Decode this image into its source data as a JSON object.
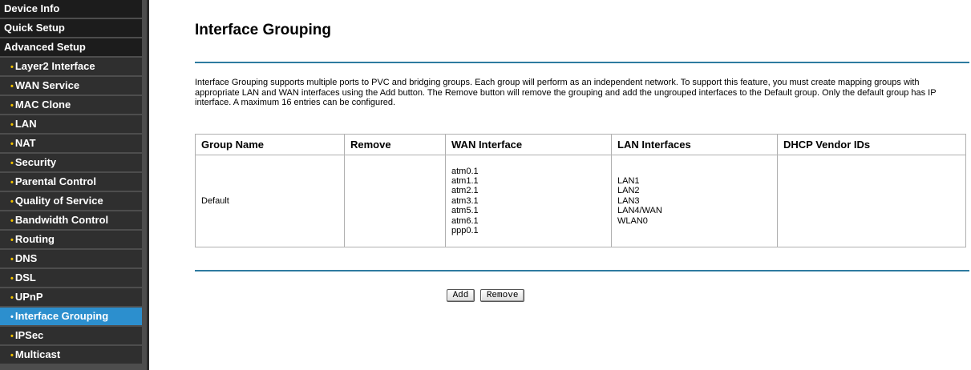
{
  "sidebar": {
    "items": [
      {
        "label": "Device Info",
        "type": "top"
      },
      {
        "label": "Quick Setup",
        "type": "top"
      },
      {
        "label": "Advanced Setup",
        "type": "top"
      },
      {
        "label": "Layer2 Interface",
        "type": "sub"
      },
      {
        "label": "WAN Service",
        "type": "sub"
      },
      {
        "label": "MAC Clone",
        "type": "sub"
      },
      {
        "label": "LAN",
        "type": "sub"
      },
      {
        "label": "NAT",
        "type": "sub"
      },
      {
        "label": "Security",
        "type": "sub"
      },
      {
        "label": "Parental Control",
        "type": "sub"
      },
      {
        "label": "Quality of Service",
        "type": "sub"
      },
      {
        "label": "Bandwidth Control",
        "type": "sub"
      },
      {
        "label": "Routing",
        "type": "sub"
      },
      {
        "label": "DNS",
        "type": "sub"
      },
      {
        "label": "DSL",
        "type": "sub"
      },
      {
        "label": "UPnP",
        "type": "sub"
      },
      {
        "label": "Interface Grouping",
        "type": "sub",
        "active": true
      },
      {
        "label": "IPSec",
        "type": "sub"
      },
      {
        "label": "Multicast",
        "type": "sub"
      }
    ],
    "bullet": "•"
  },
  "main": {
    "title": "Interface Grouping",
    "description": "Interface Grouping supports multiple ports to PVC and bridging groups. Each group will perform as an independent network. To support this feature, you must create mapping groups with appropriate LAN and WAN interfaces using the Add button. The Remove button will remove the grouping and add the ungrouped interfaces to the Default group. Only the default group has IP interface. A maximum 16 entries can be configured.",
    "table": {
      "headers": [
        "Group Name",
        "Remove",
        "WAN Interface",
        "LAN Interfaces",
        "DHCP Vendor IDs"
      ],
      "rows": [
        {
          "group_name": "Default",
          "remove": "",
          "wan_interfaces": [
            "atm0.1",
            "atm1.1",
            "atm2.1",
            "atm3.1",
            "atm5.1",
            "atm6.1",
            "ppp0.1"
          ],
          "lan_interfaces": [
            "LAN1",
            "LAN2",
            "LAN3",
            "LAN4/WAN",
            "WLAN0"
          ],
          "dhcp_vendor_ids": ""
        }
      ]
    },
    "buttons": {
      "add": "Add",
      "remove": "Remove"
    }
  },
  "colors": {
    "sidebar_bg": "#4d4d4d",
    "nav_item_bg": "#1c1c1c",
    "active_item_bg": "#2c8fce",
    "bullet": "#f2c200",
    "divider": "#2e7ba0"
  }
}
